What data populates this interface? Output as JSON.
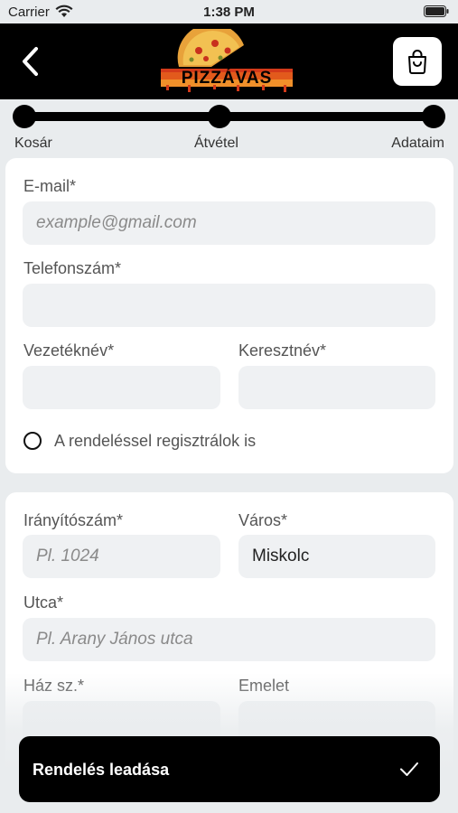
{
  "status_bar": {
    "carrier": "Carrier",
    "time": "1:38 PM"
  },
  "header": {
    "logo_text": "PIZZÁVAS"
  },
  "stepper": {
    "steps": [
      "Kosár",
      "Átvétel",
      "Adataim"
    ]
  },
  "contact": {
    "email_label": "E-mail*",
    "email_placeholder": "example@gmail.com",
    "phone_label": "Telefonszám*",
    "lastname_label": "Vezetéknév*",
    "firstname_label": "Keresztnév*",
    "register_label": "A rendeléssel regisztrálok is"
  },
  "address": {
    "zip_label": "Irányítószám*",
    "zip_placeholder": "Pl. 1024",
    "city_label": "Város*",
    "city_value": "Miskolc",
    "street_label": "Utca*",
    "street_placeholder": "Pl. Arany János utca",
    "house_label": "Ház sz.*",
    "floor_label": "Emelet"
  },
  "order_button": {
    "label": "Rendelés leadása"
  }
}
